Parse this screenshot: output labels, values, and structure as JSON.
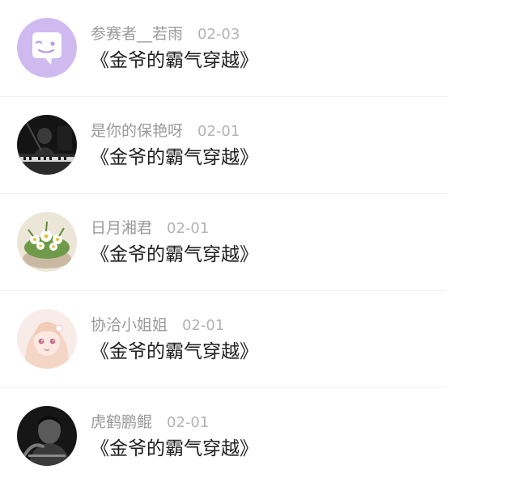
{
  "comments": [
    {
      "user": "参赛者__若雨",
      "date": "02-03",
      "title": "《金爷的霸气穿越》",
      "avatar_icon": "purple-chat-bubble-icon",
      "avatar_color": "#cdb7ee"
    },
    {
      "user": "是你的保艳呀",
      "date": "02-01",
      "title": "《金爷的霸气穿越》",
      "avatar_icon": "dark-piano-photo",
      "avatar_color": "#1a1a1a"
    },
    {
      "user": "日月湘君",
      "date": "02-01",
      "title": "《金爷的霸气穿越》",
      "avatar_icon": "daisy-flowers-photo",
      "avatar_color": "#e9e3d6"
    },
    {
      "user": "协洽小姐姐",
      "date": "02-01",
      "title": "《金爷的霸气穿越》",
      "avatar_icon": "anime-girl-photo",
      "avatar_color": "#f5e6e4"
    },
    {
      "user": "虎鹤鹏鲲",
      "date": "02-01",
      "title": "《金爷的霸气穿越》",
      "avatar_icon": "black-white-portrait-photo",
      "avatar_color": "#222222"
    }
  ]
}
